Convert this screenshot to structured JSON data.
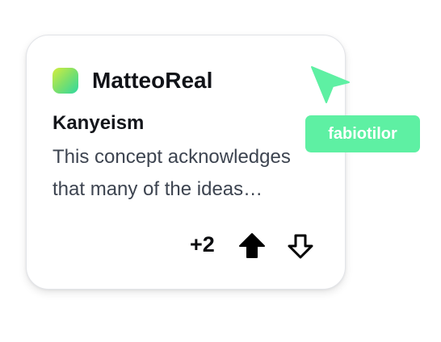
{
  "card": {
    "username": "MatteoReal",
    "title": "Kanyeism",
    "description": "This concept acknowledges that many of the ideas explored and developed",
    "score": "+2"
  },
  "cursor": {
    "label": "fabiotilor"
  },
  "colors": {
    "cursor_accent": "#5ef0a3",
    "avatar_gradient": [
      "#d4ee3e",
      "#7ee06a",
      "#2fd8a0"
    ],
    "text_primary": "#111318",
    "text_secondary": "#3d4450"
  },
  "icons": {
    "upvote": "arrow-up-filled-icon",
    "downvote": "arrow-down-outline-icon",
    "cursor": "pointer-cursor-icon"
  }
}
